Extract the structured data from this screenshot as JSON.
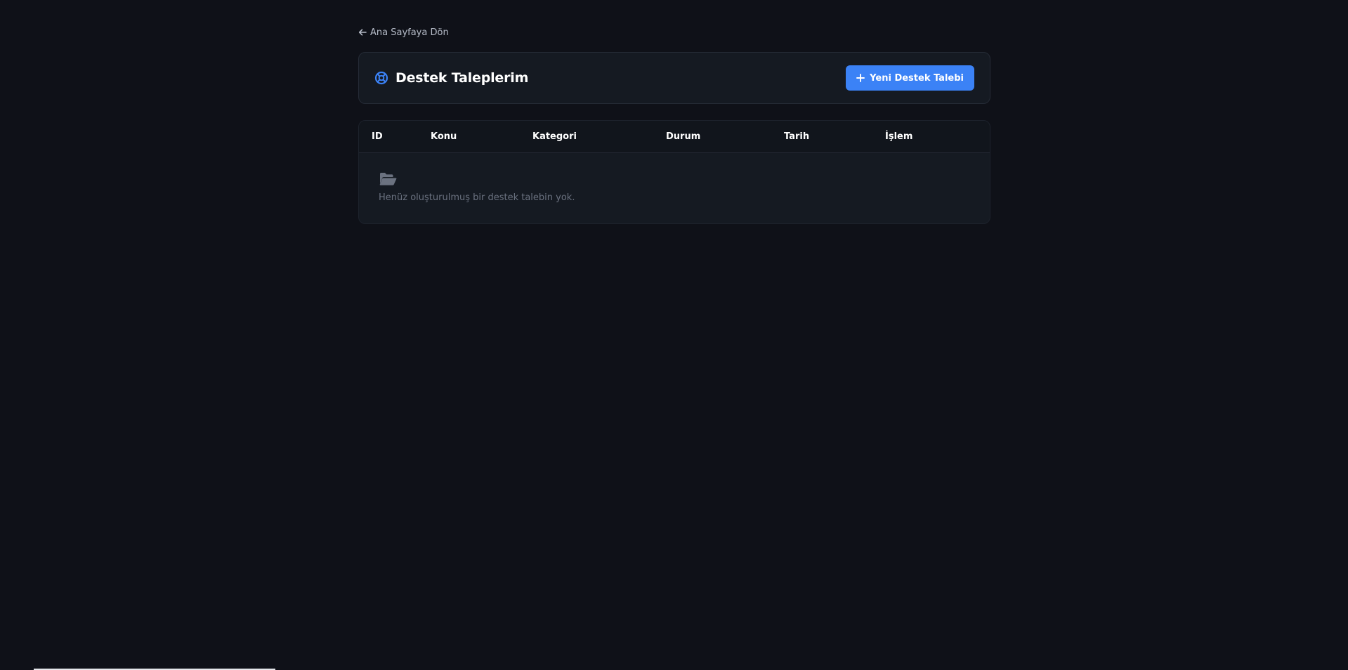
{
  "nav": {
    "back_label": "Ana Sayfaya Dön"
  },
  "header": {
    "title": "Destek Taleplerim",
    "title_icon": "life-ring-icon",
    "new_button_label": "Yeni Destek Talebi",
    "new_button_icon": "plus-icon"
  },
  "table": {
    "columns": [
      "ID",
      "Konu",
      "Kategori",
      "Durum",
      "Tarih",
      "İşlem"
    ],
    "rows": [],
    "empty_icon": "folder-open-icon",
    "empty_message": "Henüz oluşturulmuş bir destek talebin yok."
  },
  "colors": {
    "background": "#0f1118",
    "card": "#151a22",
    "accent": "#3b82f6",
    "muted_text": "#6b7280"
  }
}
